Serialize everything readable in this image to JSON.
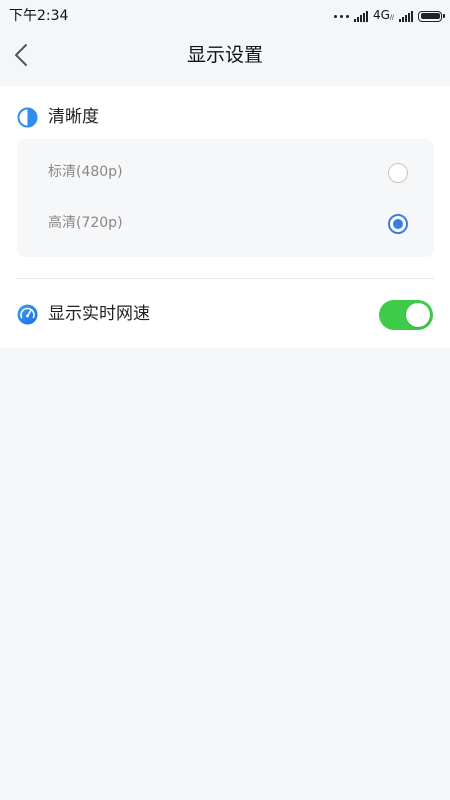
{
  "status_bar": {
    "time": "下午2:34",
    "network": "4G",
    "network_sub": "//"
  },
  "header": {
    "title": "显示设置",
    "back_icon": "chevron-left-icon"
  },
  "resolution": {
    "title": "清晰度",
    "icon": "half-circle-icon",
    "options": [
      {
        "label": "标清(480p)",
        "selected": false
      },
      {
        "label": "高清(720p)",
        "selected": true
      }
    ]
  },
  "network_speed": {
    "label": "显示实时网速",
    "icon": "speedometer-icon",
    "enabled": true
  },
  "colors": {
    "accent": "#3a7be8",
    "toggle_on": "#3ecb4a",
    "background": "#f4f7fa",
    "card": "#ffffff"
  }
}
